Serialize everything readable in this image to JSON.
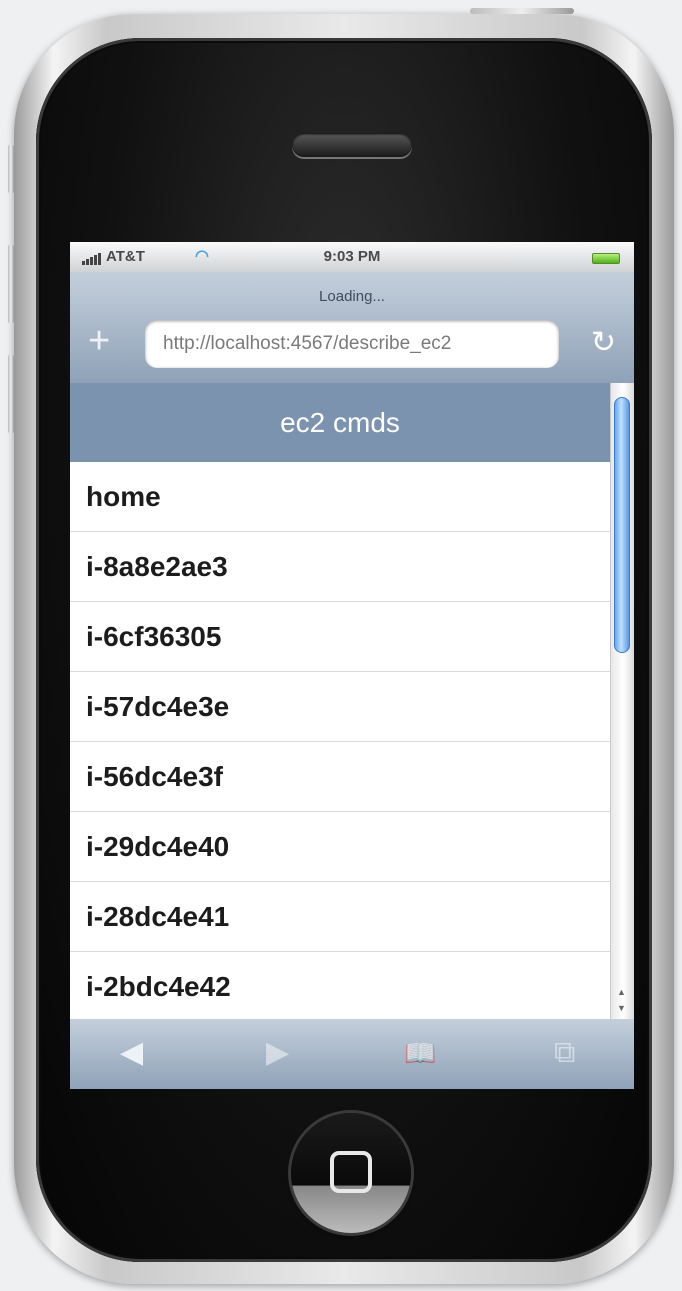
{
  "status_bar": {
    "carrier": "AT&T",
    "time": "9:03 PM"
  },
  "browser": {
    "loading_text": "Loading...",
    "url": "http://localhost:4567/describe_ec2",
    "add_button": "+",
    "reload_button": "↻"
  },
  "page": {
    "title": "ec2 cmds",
    "items": [
      "home",
      "i-8a8e2ae3",
      "i-6cf36305",
      "i-57dc4e3e",
      "i-56dc4e3f",
      "i-29dc4e40",
      "i-28dc4e41",
      "i-2bdc4e42"
    ]
  },
  "toolbar": {
    "back": "◀",
    "forward": "▶",
    "bookmarks": "📖",
    "pages": "⧉"
  },
  "icons": {
    "signal": "signal-icon",
    "wifi": "wifi-icon",
    "battery": "battery-icon"
  },
  "colors": {
    "title_bar": "#7b93af",
    "chrome": "#8fa2b8",
    "scroll_thumb": "#5a9ee8"
  }
}
